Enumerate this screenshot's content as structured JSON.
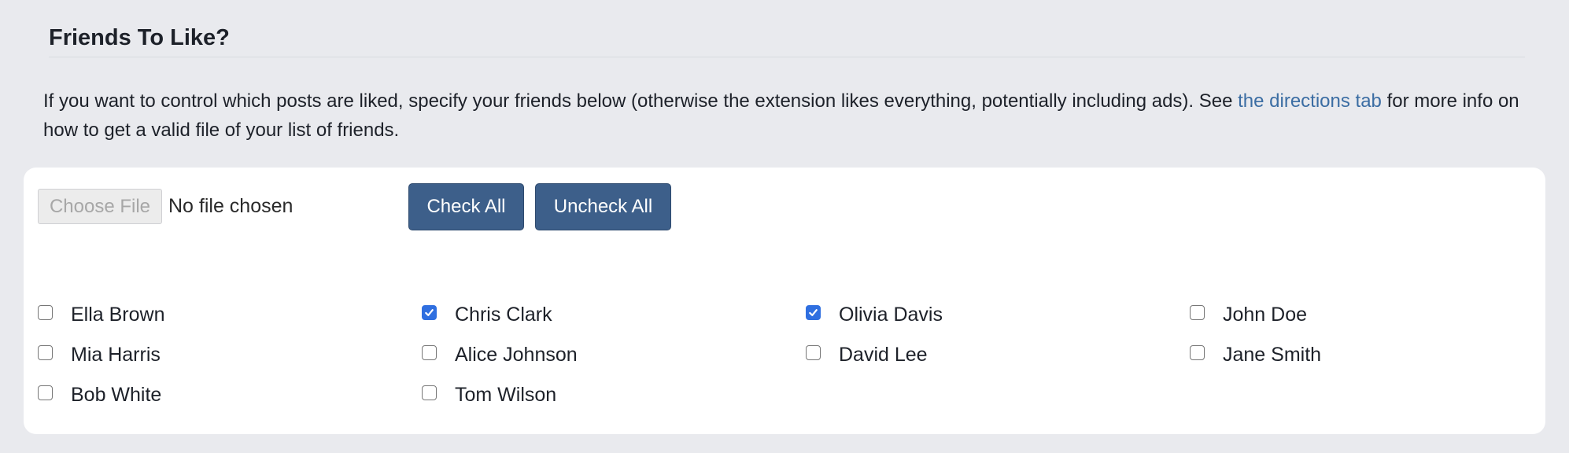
{
  "section": {
    "title": "Friends To Like?"
  },
  "intro": {
    "text_before": "If you want to control which posts are liked, specify your friends below (otherwise the extension likes everything, potentially including ads). See ",
    "link_text": "the directions tab",
    "text_after": " for more info on how to get a valid file of your list of friends."
  },
  "file_input": {
    "button_label": "Choose File",
    "status": "No file chosen"
  },
  "buttons": {
    "check_all": "Check All",
    "uncheck_all": "Uncheck All"
  },
  "friends": [
    {
      "name": "Ella Brown",
      "checked": false
    },
    {
      "name": "Chris Clark",
      "checked": true
    },
    {
      "name": "Olivia Davis",
      "checked": true
    },
    {
      "name": "John Doe",
      "checked": false
    },
    {
      "name": "Mia Harris",
      "checked": false
    },
    {
      "name": "Alice Johnson",
      "checked": false
    },
    {
      "name": "David Lee",
      "checked": false
    },
    {
      "name": "Jane Smith",
      "checked": false
    },
    {
      "name": "Bob White",
      "checked": false
    },
    {
      "name": "Tom Wilson",
      "checked": false
    }
  ],
  "colors": {
    "page_background": "#e9eaee",
    "card_background": "#ffffff",
    "button_primary": "#3d5f8a",
    "link": "#3b6da3",
    "checkbox_checked": "#2f6fe0"
  }
}
